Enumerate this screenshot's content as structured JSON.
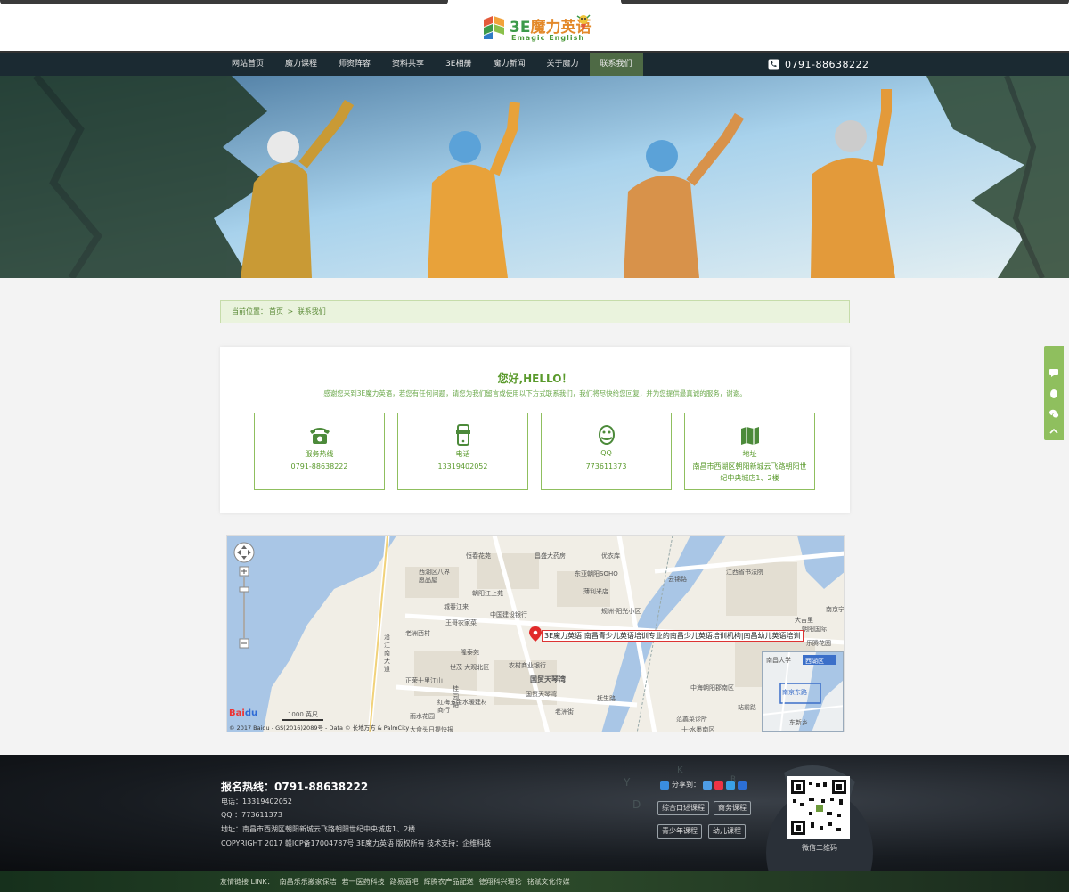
{
  "logo": {
    "cn_num": "3E",
    "cn_text": "魔力英语",
    "en_text": "Emagic English",
    "mark": "3E"
  },
  "nav": {
    "items": [
      "网站首页",
      "魔力课程",
      "师资阵容",
      "资料共享",
      "3E相册",
      "魔力新闻",
      "关于魔力",
      "联系我们"
    ],
    "active_index": 7,
    "phone": "0791-88638222"
  },
  "breadcrumb": {
    "prefix": "当前位置：",
    "home": "首页",
    "sep": " > ",
    "current": "联系我们"
  },
  "contact": {
    "title": "您好,HELLO！",
    "intro": "感谢您来到3E魔力英语，若您有任何问题，请您为我们留言或使用以下方式联系我们，我们将尽快给您回复，并为您提供最真诚的服务，谢谢。",
    "boxes": [
      {
        "icon": "telephone-icon",
        "label": "服务热线",
        "value": "0791-88638222"
      },
      {
        "icon": "mobile-phone-icon",
        "label": "电话",
        "value": "13319402052"
      },
      {
        "icon": "qq-penguin-icon",
        "label": "QQ",
        "value": "773611373"
      },
      {
        "icon": "map-icon",
        "label": "地址",
        "value": "南昌市西湖区朝阳新城云飞路朝阳世纪中央城店1、2楼"
      }
    ]
  },
  "map": {
    "popup": "3E魔力英语|南昌青少儿英语培训专业的南昌少儿英语培训机构|南昌幼儿英语培训",
    "labels": [
      "恒春花苑",
      "昌盛大药房",
      "优衣库",
      "西湖区八界",
      "愿品屋",
      "东亚朝阳SOHO",
      "江西省书法院",
      "朝阳江上苑",
      "薄利米店",
      "云锦路",
      "城春江来",
      "中国建设银行",
      "规洲·阳光小区",
      "南京宁",
      "王哥农家菜",
      "老洲西村",
      "大吉里",
      "朝阳国际",
      "乐腾花园",
      "隆泰苑",
      "沿江南大道",
      "世茂·大观北区",
      "农村商业银行",
      "国贸天琴湾",
      "正荣十里江山",
      "桂园路",
      "国贸天琴湾",
      "中海朝阳郡南区",
      "红梅五金水暖建材商行",
      "抚生路",
      "老洲街",
      "南昌大学",
      "西湖区",
      "南京东路",
      "雨水花园",
      "范蠡菜诊所",
      "十·水墨南区",
      "大食头日提快报",
      "东新乡",
      "站前路"
    ],
    "scale": "1000 英尺",
    "copyright": "© 2017 Baidu - GS(2016)2089号 - Data © 长地万方 & PalmCity"
  },
  "side_widget": {
    "icons": [
      "message-icon",
      "qq-icon",
      "wechat-icon",
      "up-arrow-icon"
    ]
  },
  "footer": {
    "hotline": "报名热线：0791-88638222",
    "phone": "电话：13319402052",
    "qq": "QQ   ：773611373",
    "address": "地址：南昌市西湖区朝阳新城云飞路朝阳世纪中央城店1、2楼",
    "copyright": "COPYRIGHT 2017 赣ICP备17004787号 3E魔力英语 版权所有  技术支持：企维科技",
    "share_label": "分享到：",
    "courses": [
      "综合口述课程",
      "商务课程",
      "青少年课程",
      "幼儿课程"
    ],
    "qr_label": "微信二维码"
  },
  "friend_links": {
    "prefix": "友情链接 LINK：",
    "links": [
      "南昌乐乐搬家保洁",
      "若一医药科技",
      "路易酒吧",
      "辉腾农产品配送",
      "德翔科兴理论",
      "铭赋文化传媒"
    ]
  },
  "colors": {
    "accent": "#5a9a2c",
    "nav_bg": "#1b2a32",
    "nav_active": "#4e6a45",
    "side_widget": "#8fbf5e"
  }
}
